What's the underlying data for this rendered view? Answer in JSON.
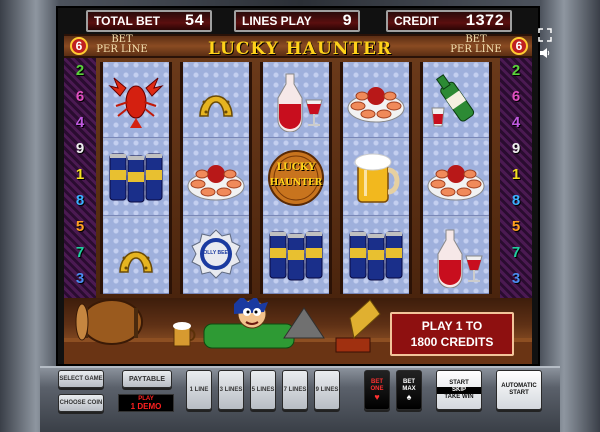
{
  "meters": {
    "total_bet_label": "TOTAL BET",
    "total_bet": "54",
    "lines_label": "LINES PLAY",
    "lines": "9",
    "credit_label": "CREDIT",
    "credit": "1372"
  },
  "title": "LUCKY HAUNTER",
  "bet_per_line": {
    "label_top": "BET",
    "label_bottom": "PER LINE",
    "value": "6"
  },
  "left_lines": [
    "2",
    "6",
    "4",
    "9",
    "1",
    "8",
    "5",
    "7",
    "3"
  ],
  "right_lines": [
    "2",
    "6",
    "4",
    "9",
    "1",
    "8",
    "5",
    "7",
    "3"
  ],
  "line_colors": {
    "1": "#f4e020",
    "2": "#5ad23a",
    "3": "#4a8cf0",
    "4": "#c05ae0",
    "5": "#ffa020",
    "6": "#e050c0",
    "7": "#20d0a0",
    "8": "#3ab0ff",
    "9": "#f0f0f0"
  },
  "reels": [
    [
      "lobster",
      "beer-cans",
      "horseshoe"
    ],
    [
      "horseshoe",
      "shrimp-plate",
      "bottle-cap"
    ],
    [
      "wine-carafe",
      "lucky-haunter-logo",
      "beer-cans"
    ],
    [
      "shrimp-plate",
      "beer-mug",
      "beer-cans"
    ],
    [
      "green-bottle",
      "shrimp-plate",
      "wine-carafe"
    ]
  ],
  "logo_text": {
    "top": "LUCKY",
    "bottom": "HAUNTER"
  },
  "cap_text": "JOLLY BEER",
  "promo": {
    "line1": "PLAY 1 TO",
    "line2": "1800 CREDITS"
  },
  "buttons": {
    "select_game": "SELECT GAME",
    "choose_coin": "CHOOSE COIN",
    "paytable": "PAYTABLE",
    "demo_top": "PLAY",
    "demo_bottom": "1 DEMO",
    "line1": "1 LINE",
    "line3": "3 LINES",
    "line5": "5 LINES",
    "line7": "7 LINES",
    "line9": "9 LINES",
    "bet_one_top": "BET",
    "bet_one_bottom": "ONE",
    "bet_max_top": "BET",
    "bet_max_bottom": "MAX",
    "start_skip_top": "START",
    "start_skip_mid": "SKIP",
    "start_skip_bottom": "TAKE WIN",
    "auto_start_top": "AUTOMATIC",
    "auto_start_bottom": "START"
  },
  "icons": {
    "fullscreen": "fullscreen-icon",
    "sound": "speaker-icon"
  }
}
